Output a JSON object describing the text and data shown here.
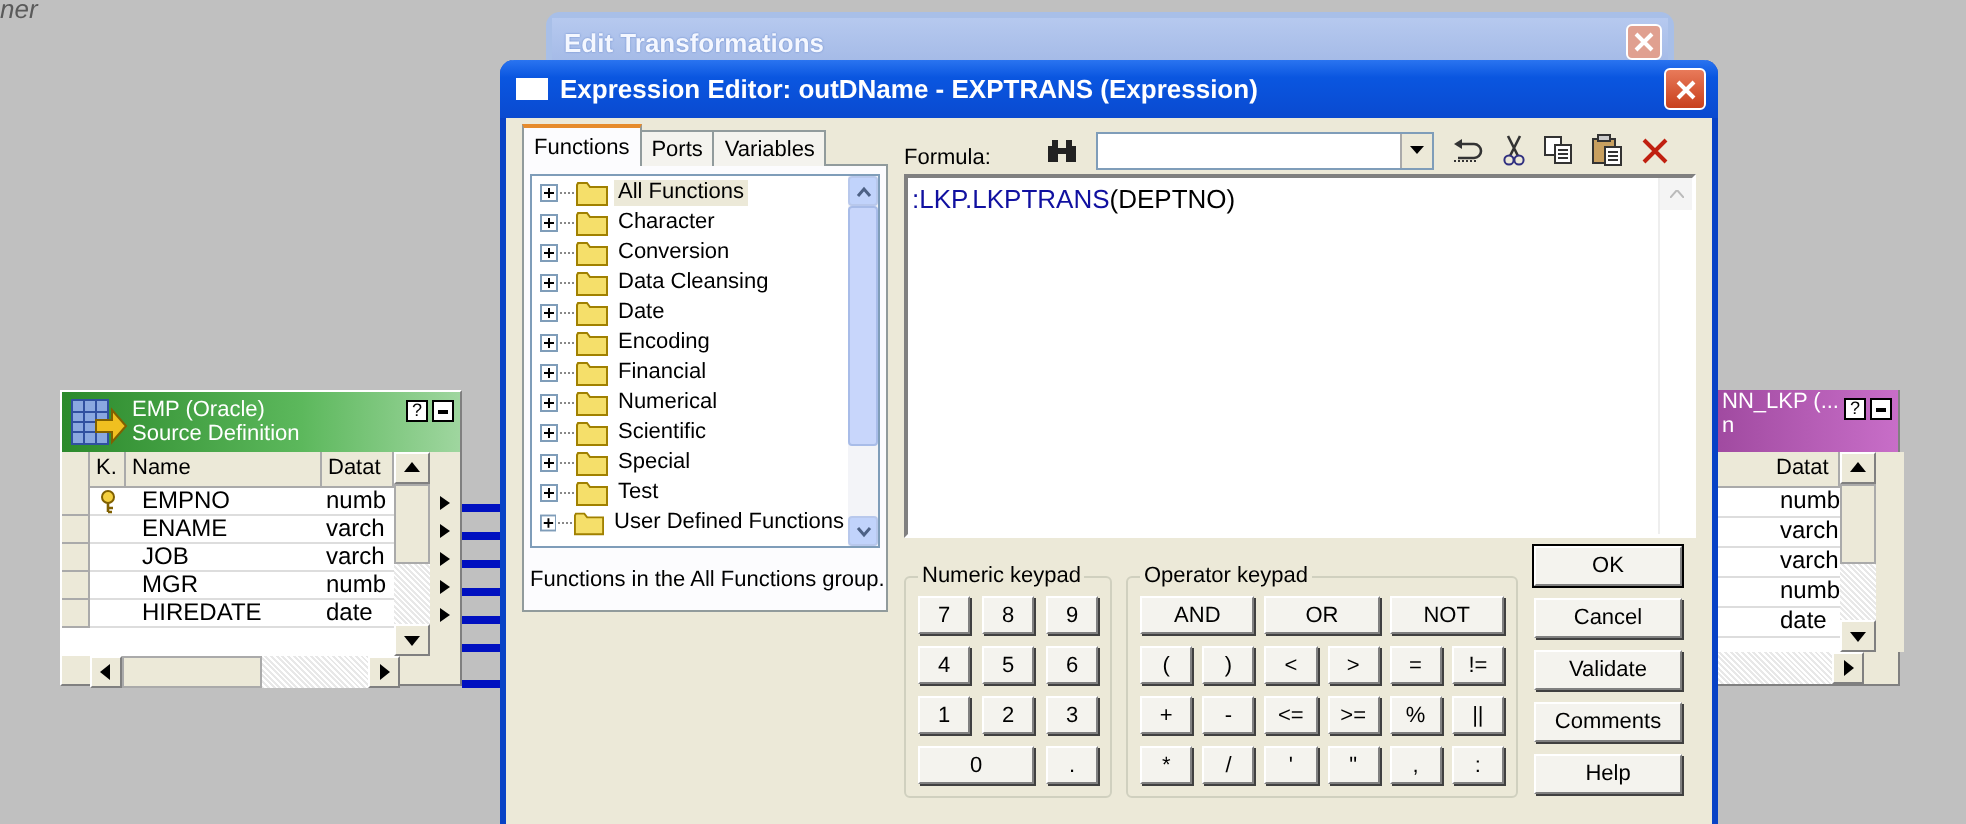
{
  "canvas": {
    "label": "ner"
  },
  "back_window": {
    "title": "Edit Transformations"
  },
  "source_table": {
    "title": "EMP (Oracle)",
    "subtitle": "Source Definition",
    "help_label": "?",
    "columns": [
      "K.",
      "Name",
      "Datat"
    ],
    "rows": [
      {
        "key": true,
        "name": "EMPNO",
        "type": "numb"
      },
      {
        "key": false,
        "name": "ENAME",
        "type": "varch"
      },
      {
        "key": false,
        "name": "JOB",
        "type": "varch"
      },
      {
        "key": false,
        "name": "MGR",
        "type": "numb"
      },
      {
        "key": false,
        "name": "HIREDATE",
        "type": "date"
      }
    ]
  },
  "target_table": {
    "title": "NN_LKP (...",
    "subtitle": "n",
    "help_label": "?",
    "columns": [
      "Datat"
    ],
    "rows": [
      {
        "type": "numb"
      },
      {
        "type": "varch"
      },
      {
        "type": "varch"
      },
      {
        "type": "numb"
      },
      {
        "type": "date"
      }
    ]
  },
  "editor": {
    "title": "Expression Editor: outDName - EXPTRANS (Expression)",
    "tabs": [
      {
        "label": "Functions",
        "selected": true
      },
      {
        "label": "Ports",
        "selected": false
      },
      {
        "label": "Variables",
        "selected": false
      }
    ],
    "tree": [
      {
        "label": "All Functions",
        "selected": true
      },
      {
        "label": "Character",
        "selected": false
      },
      {
        "label": "Conversion",
        "selected": false
      },
      {
        "label": "Data Cleansing",
        "selected": false
      },
      {
        "label": "Date",
        "selected": false
      },
      {
        "label": "Encoding",
        "selected": false
      },
      {
        "label": "Financial",
        "selected": false
      },
      {
        "label": "Numerical",
        "selected": false
      },
      {
        "label": "Scientific",
        "selected": false
      },
      {
        "label": "Special",
        "selected": false
      },
      {
        "label": "Test",
        "selected": false
      },
      {
        "label": "User Defined Functions",
        "selected": false
      }
    ],
    "description": "Functions in the All Functions group.",
    "formula_label": "Formula:",
    "formula": [
      {
        "kind": "function",
        "text": ":LKP.LKPTRANS"
      },
      {
        "kind": "plain",
        "text": "(DEPTNO)"
      }
    ],
    "numeric_keypad": {
      "title": "Numeric keypad",
      "keys": [
        "7",
        "8",
        "9",
        "4",
        "5",
        "6",
        "1",
        "2",
        "3",
        "0",
        "."
      ]
    },
    "operator_keypad": {
      "title": "Operator keypad",
      "rows": [
        [
          "AND",
          "OR",
          "NOT"
        ],
        [
          "(",
          ")",
          "<",
          ">",
          "=",
          "!="
        ],
        [
          "+",
          "-",
          "<=",
          ">=",
          "%",
          "||"
        ],
        [
          "*",
          "/",
          "'",
          "\"",
          ",",
          ":"
        ]
      ]
    },
    "buttons": [
      {
        "label": "OK",
        "default": true
      },
      {
        "label": "Cancel",
        "default": false
      },
      {
        "label": "Validate",
        "default": false
      },
      {
        "label": "Comments",
        "default": false
      },
      {
        "label": "Help",
        "default": false
      }
    ]
  }
}
